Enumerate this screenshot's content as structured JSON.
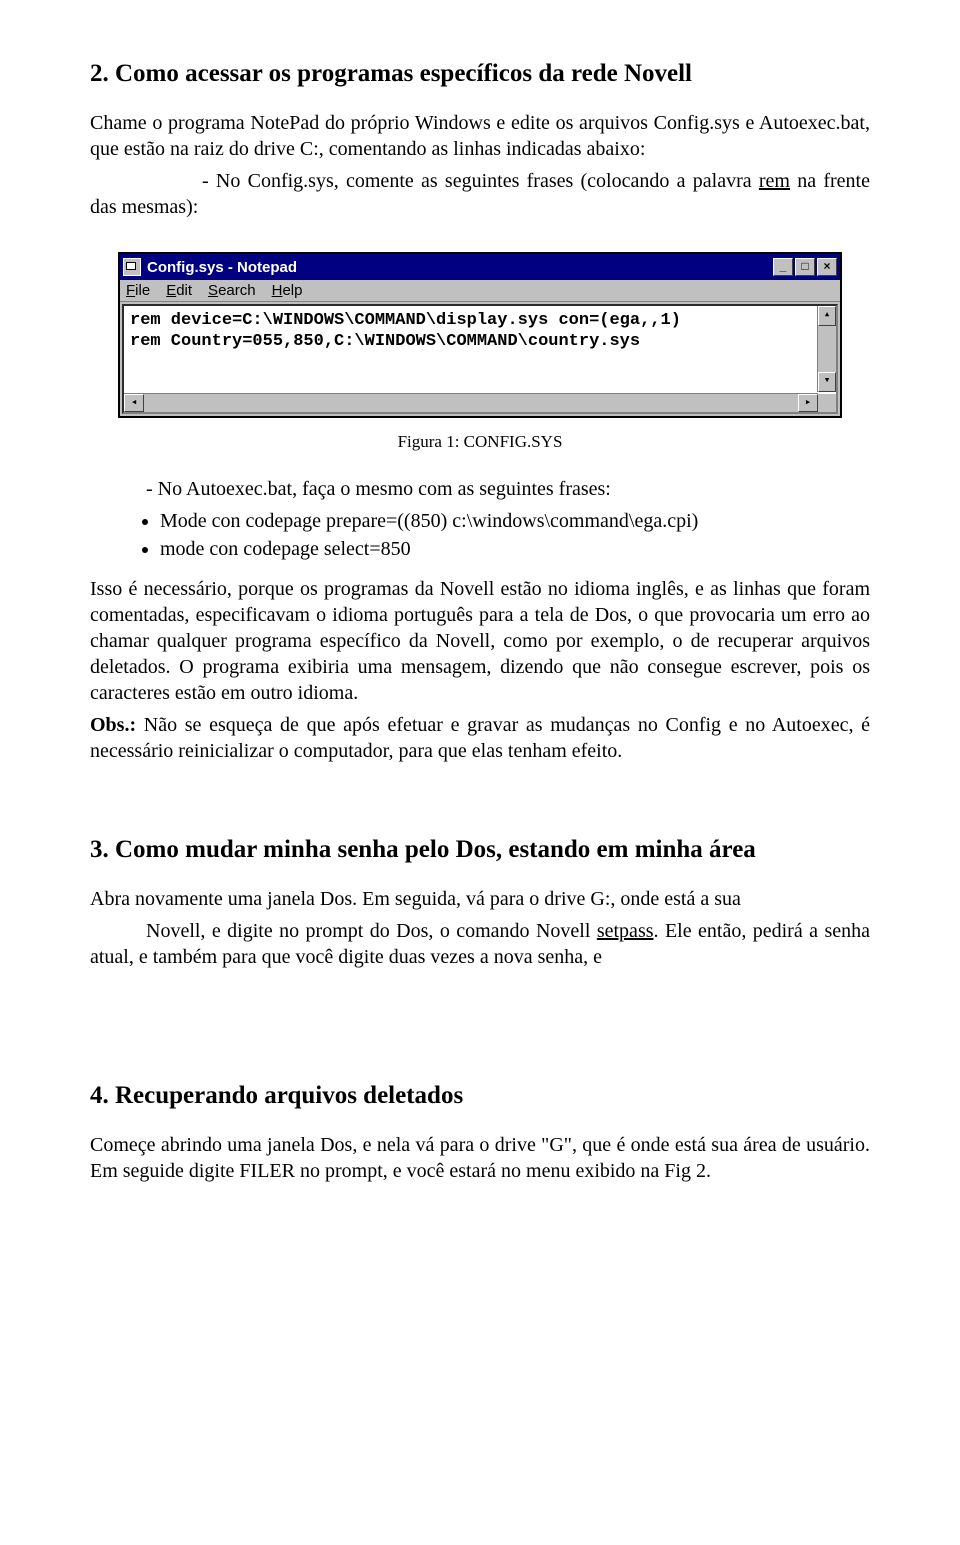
{
  "section2": {
    "heading": "2. Como acessar os programas específicos da rede Novell",
    "p1a": "Chame o programa NotePad do próprio Windows e edite os arquivos Config.sys e Autoexec.bat, que estão na raiz do drive C:, comentando as linhas indicadas abaixo:",
    "li1a": "- No Config.sys, comente as seguintes frases (colocando a palavra ",
    "li1_rem": "rem",
    "li1b": " na frente das mesmas):"
  },
  "notepad": {
    "title": "Config.sys - Notepad",
    "menu": {
      "file": "File",
      "edit": "Edit",
      "search": "Search",
      "help": "Help"
    },
    "line1": "rem device=C:\\WINDOWS\\COMMAND\\display.sys con=(ega,,1)",
    "line2": "rem Country=055,850,C:\\WINDOWS\\COMMAND\\country.sys",
    "btn_min": "_",
    "btn_max": "□",
    "btn_close": "×",
    "arrow_up": "▴",
    "arrow_down": "▾",
    "arrow_left": "◂",
    "arrow_right": "▸"
  },
  "caption1": "Figura 1: CONFIG.SYS",
  "after_fig": {
    "li2": "- No Autoexec.bat, faça o mesmo com as seguintes frases:",
    "b1": "Mode con codepage prepare=((850) c:\\windows\\command\\ega.cpi)",
    "b2": "mode con codepage select=850"
  },
  "para2": "Isso é necessário, porque os programas da Novell estão no idioma inglês, e as linhas que foram comentadas, especificavam o idioma português para a tela de Dos, o que provocaria um erro ao chamar qualquer programa específico da Novell, como por exemplo, o de recuperar arquivos deletados. O programa exibiria uma mensagem, dizendo que não consegue escrever, pois os caracteres estão em outro idioma.",
  "obs_label": "Obs.:",
  "obs_text": " Não se esqueça de que após efetuar e gravar as mudanças no Config e no Autoexec, é necessário reinicializar o computador, para que elas tenham efeito.",
  "section3": {
    "heading": "3. Como mudar minha senha pelo Dos, estando em minha área",
    "p1a": "Abra novamente uma janela Dos. Em seguida, vá para o drive G:, onde está a sua",
    "p1b_prefix": "Novell, e digite no prompt do Dos, o comando Novell ",
    "setpass": "setpass",
    "p1b_suffix": ". Ele então, pedirá a senha atual, e também para que você digite duas vezes a nova senha, e"
  },
  "section4": {
    "heading": "4. Recuperando arquivos deletados",
    "p1": "Começe abrindo uma janela Dos, e nela vá para o drive \"G\", que é onde está sua área de usuário. Em seguide digite FILER no prompt, e você estará no menu exibido na Fig 2."
  }
}
